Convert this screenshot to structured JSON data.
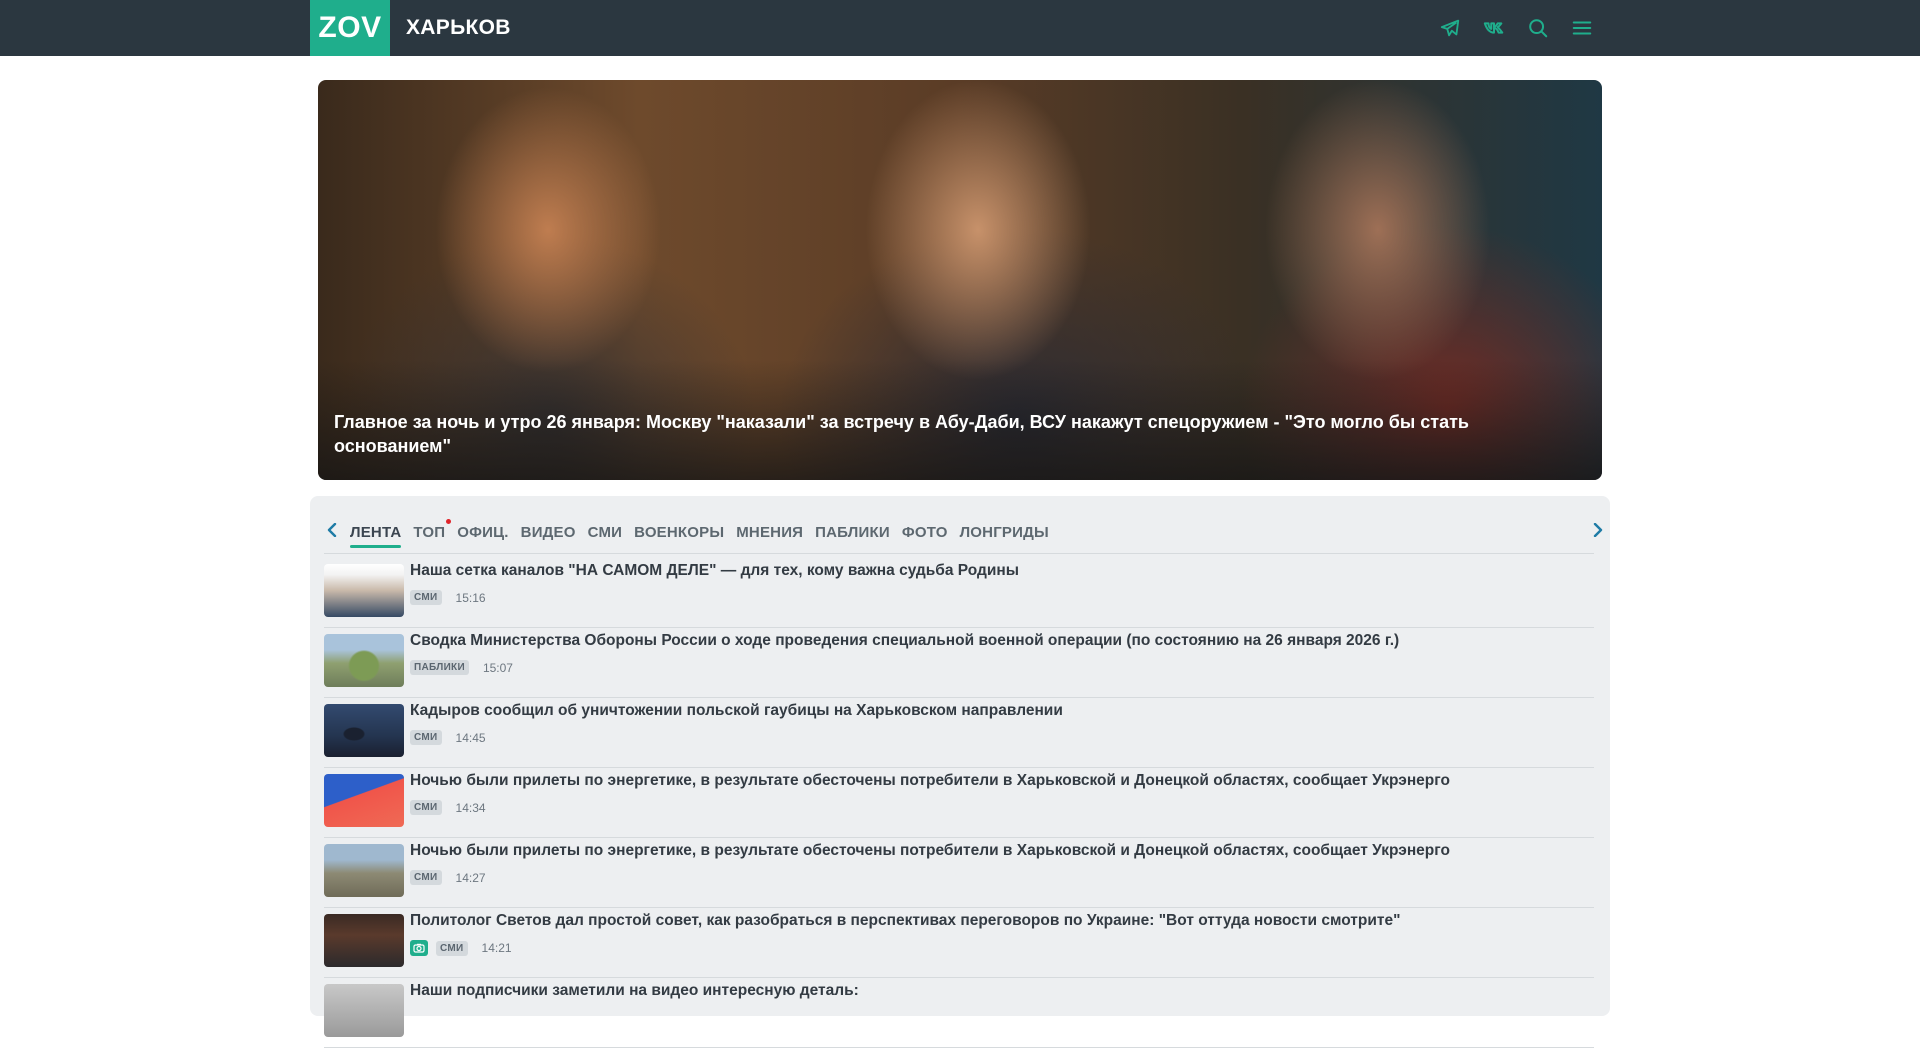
{
  "header": {
    "logo": "ZOV",
    "city": "ХАРЬКОВ",
    "icons": [
      "telegram-icon",
      "vk-icon",
      "search-icon",
      "menu-icon"
    ],
    "colors": {
      "bar": "#2b3740",
      "accent": "#1fae8c"
    }
  },
  "hero": {
    "title": "Главное за ночь и утро 26 января: Москву \"наказали\" за встречу в Абу-Даби, ВСУ накажут спецоружием - \"Это могло бы стать основанием\""
  },
  "tabs": [
    {
      "label": "ЛЕНТА",
      "active": true
    },
    {
      "label": "ТОП",
      "dot": true
    },
    {
      "label": "ОФИЦ."
    },
    {
      "label": "ВИДЕО"
    },
    {
      "label": "СМИ"
    },
    {
      "label": "ВОЕНКОРЫ"
    },
    {
      "label": "МНЕНИЯ"
    },
    {
      "label": "ПАБЛИКИ"
    },
    {
      "label": "ФОТО"
    },
    {
      "label": "ЛОНГРИДЫ"
    }
  ],
  "feed": [
    {
      "title": "Наша сетка каналов \"НА САМОМ ДЕЛЕ\" — для тех, кому важна судьба Родины",
      "badge": "СМИ",
      "time": "15:16"
    },
    {
      "title": "Сводка Министерства Обороны России о ходе проведения специальной военной операции (по состоянию на 26 января 2026 г.)",
      "badge": "ПАБЛИКИ",
      "time": "15:07"
    },
    {
      "title": "Кадыров сообщил об уничтожении польской гаубицы на Харьковском направлении",
      "badge": "СМИ",
      "time": "14:45"
    },
    {
      "title": "Ночью были прилеты по энергетике, в результате обесточены потребители в Харьковской и Донецкой областях, сообщает Укрэнерго",
      "badge": "СМИ",
      "time": "14:34"
    },
    {
      "title": "Ночью были прилеты по энергетике, в результате обесточены потребители в Харьковской и Донецкой областях, сообщает Укрэнерго",
      "badge": "СМИ",
      "time": "14:27"
    },
    {
      "title": "Политолог Светов дал простой совет, как разобраться в перспективах переговоров по Украине: \"Вот оттуда новости смотрите\"",
      "badge": "СМИ",
      "time": "14:21",
      "photo": true
    },
    {
      "title": "Наши подписчики заметили на видео интересную деталь:",
      "badge": "",
      "time": ""
    }
  ]
}
